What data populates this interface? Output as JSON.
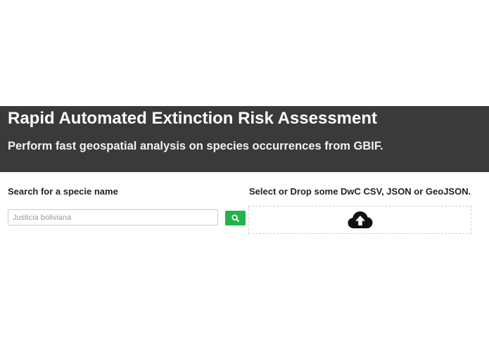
{
  "header": {
    "title": "Rapid Automated Extinction Risk Assessment",
    "subtitle": "Perform fast geospatial analysis on species occurrences from GBIF."
  },
  "search": {
    "label": "Search for a specie name",
    "placeholder": "Justicia boliviana",
    "button_icon": "search-icon",
    "button_color": "#22b34a"
  },
  "upload": {
    "label": "Select or Drop some DwC CSV, JSON or GeoJSON.",
    "icon": "cloud-upload-icon"
  },
  "colors": {
    "hero_background": "#3a3a3a",
    "accent": "#22b34a"
  }
}
